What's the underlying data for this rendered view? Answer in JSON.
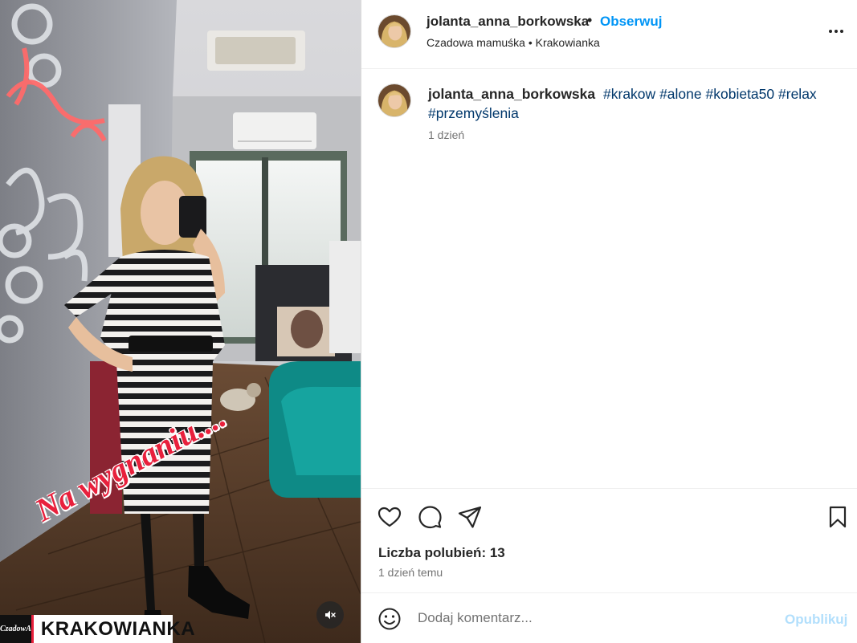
{
  "post": {
    "username": "jolanta_anna_borkowska",
    "separator": "•",
    "follow_label": "Obserwuj",
    "subtitle": "Czadowa mamuśka • Krakowianka",
    "more_icon": "more-horizontal-icon"
  },
  "media": {
    "sticker_text": "Na wygnaniu....",
    "brand_logo_text": "CzadowA",
    "brand_name": "KRAKOWIANKA",
    "mute_icon": "speaker-muted-icon"
  },
  "caption": {
    "username": "jolanta_anna_borkowska",
    "tags": [
      "#krakow",
      "#alone",
      "#kobieta50",
      "#relax",
      "#przemyślenia"
    ],
    "time": "1 dzień"
  },
  "actions": {
    "like_icon": "heart-icon",
    "comment_icon": "comment-icon",
    "share_icon": "share-icon",
    "save_icon": "bookmark-icon",
    "likes_text": "Liczba polubień: 13",
    "posted_text": "1 dzień temu"
  },
  "comment_bar": {
    "emoji_icon": "emoji-icon",
    "placeholder": "Dodaj komentarz...",
    "publish_label": "Opublikuj"
  },
  "colors": {
    "link_blue": "#0095f6",
    "hashtag": "#00376b",
    "publish_disabled": "#b2dffc",
    "sticker_red": "#e8203c"
  }
}
